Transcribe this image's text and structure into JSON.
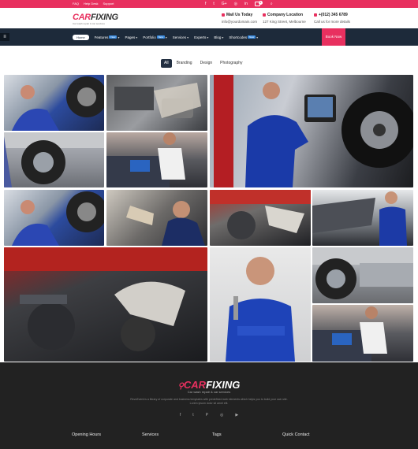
{
  "topbar": {
    "links": [
      "FAQ",
      "Help Desk",
      "Support"
    ],
    "social": [
      "f",
      "t",
      "G+",
      "◎",
      "in"
    ],
    "cart_count": "0",
    "search_icon": "⌕"
  },
  "header": {
    "logo_a": "CAR",
    "logo_b": "FIXING",
    "logo_tag": "Car wash repair & car services",
    "mail_title": "Mail Us Today",
    "mail_value": "info@yourdomain.com",
    "location_title": "Company Location",
    "location_value": "127 King Street, Melbourne",
    "phone_title": "+(012) 345 6789",
    "phone_value": "Call us for more details"
  },
  "nav": {
    "items": [
      {
        "label": "Home",
        "badge": "",
        "caret": ""
      },
      {
        "label": "Features",
        "badge": "New",
        "caret": "▾"
      },
      {
        "label": "Pages",
        "badge": "",
        "caret": "▾"
      },
      {
        "label": "Portfolio",
        "badge": "New",
        "caret": "▾"
      },
      {
        "label": "Services",
        "badge": "",
        "caret": "▾"
      },
      {
        "label": "Experts",
        "badge": "",
        "caret": "▾"
      },
      {
        "label": "Blog",
        "badge": "",
        "caret": "▾"
      },
      {
        "label": "Shortcodes",
        "badge": "New",
        "caret": "▾"
      }
    ],
    "book_label": "Book Now",
    "menu_icon": "≡"
  },
  "filters": [
    "All",
    "Branding",
    "Design",
    "Photography"
  ],
  "footer": {
    "logo_a": "CAR",
    "logo_b": "FIXING",
    "logo_tag": "Car wash repair & car services",
    "desc": "RevoEvent is a library of corporate and business templates with predefined web elements which helps you to build your own site. Lorem ipsum dolor sit amet elit.",
    "social": [
      "f",
      "t",
      "P",
      "◎",
      "▶"
    ],
    "columns": [
      "Opening Hours",
      "Services",
      "Tags",
      "Quick Contact"
    ]
  },
  "colors": {
    "accent": "#e8305f",
    "nav": "#1d2a3a",
    "footer": "#222222"
  }
}
